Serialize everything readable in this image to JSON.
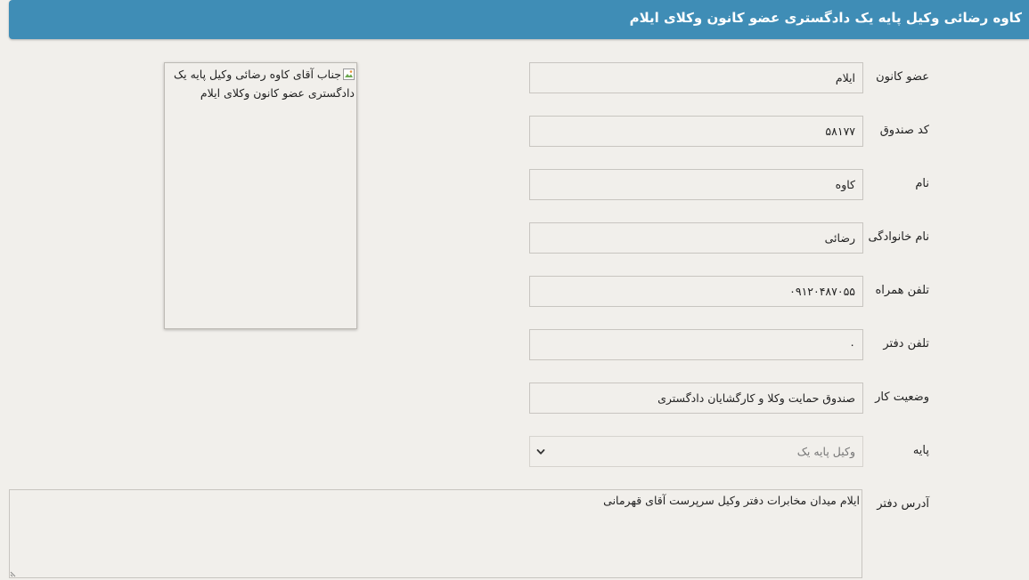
{
  "header": {
    "title": "کاوه رضائی وکیل پایه یک دادگستری عضو کانون وکلای ایلام"
  },
  "form": {
    "member_of": {
      "label": "عضو کانون",
      "value": "ایلام"
    },
    "fund_code": {
      "label": "کد صندوق",
      "value": "۵۸۱۷۷"
    },
    "first_name": {
      "label": "نام",
      "value": "کاوه"
    },
    "last_name": {
      "label": "نام خانوادگی",
      "value": "رضائی"
    },
    "mobile": {
      "label": "تلفن همراه",
      "value": "۰۹۱۲۰۴۸۷۰۵۵"
    },
    "office_phone": {
      "label": "تلفن دفتر",
      "value": "۰"
    },
    "work_status": {
      "label": "وضعیت کار",
      "value": "صندوق حمایت وکلا و کارگشایان دادگستری"
    },
    "grade": {
      "label": "پایه",
      "selected": "وکیل پایه یک"
    },
    "office_address": {
      "label": "آدرس دفتر",
      "value": "ایلام میدان مخابرات دفتر وکیل سرپرست آقای قهرمانی"
    }
  },
  "photo": {
    "alt_text": "جناب آقای کاوه رضائی وکیل پایه یک دادگستری عضو کانون وکلای ایلام",
    "icon": "broken-image-icon"
  },
  "colors": {
    "header_bg": "#3f8db6",
    "page_bg": "#f1efeb"
  }
}
